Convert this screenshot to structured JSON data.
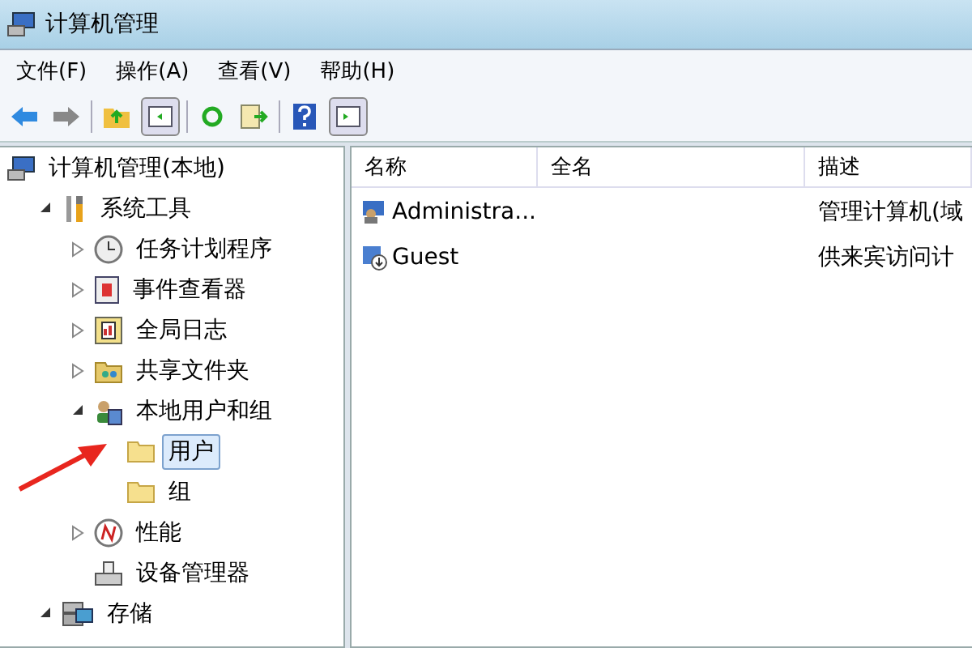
{
  "window": {
    "title": "计算机管理"
  },
  "menu": [
    "文件(F)",
    "操作(A)",
    "查看(V)",
    "帮助(H)"
  ],
  "tree": [
    {
      "label": "计算机管理(本地)",
      "selected": false,
      "children": [
        {
          "label": "系统工具",
          "selected": false,
          "expanded": true,
          "children": [
            {
              "label": "任务计划程序",
              "selected": false,
              "expanded": false
            },
            {
              "label": "事件查看器",
              "selected": false,
              "expanded": false
            },
            {
              "label": "全局日志",
              "selected": false,
              "expanded": false
            },
            {
              "label": "共享文件夹",
              "selected": false,
              "expanded": false
            },
            {
              "label": "本地用户和组",
              "selected": false,
              "expanded": true,
              "children": [
                {
                  "label": "用户",
                  "selected": true
                },
                {
                  "label": "组",
                  "selected": false
                }
              ]
            },
            {
              "label": "性能",
              "selected": false,
              "expanded": false
            },
            {
              "label": "设备管理器",
              "selected": false
            }
          ]
        },
        {
          "label": "存储",
          "selected": false,
          "expanded": true
        }
      ]
    }
  ],
  "table": {
    "columns": [
      "名称",
      "全名",
      "描述"
    ],
    "rows": [
      {
        "name": "Administra...",
        "description": "管理计算机(域"
      },
      {
        "name": "Guest",
        "description": "供来宾访问计"
      }
    ]
  }
}
